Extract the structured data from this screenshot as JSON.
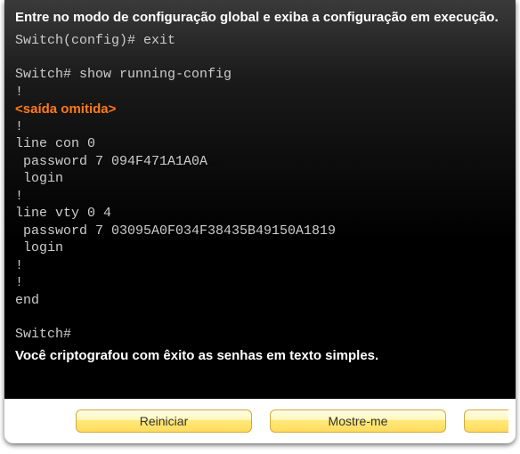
{
  "heading": "Entre no modo de configuração global e exiba a configuração em execução.",
  "terminal": {
    "lines": [
      "Switch(config)# exit",
      "",
      "Switch# show running-config",
      "!"
    ],
    "annotation": "<saída omitida>",
    "lines2": [
      "!",
      "line con 0",
      " password 7 094F471A1A0A",
      " login",
      "!",
      "line vty 0 4",
      " password 7 03095A0F034F38435B49150A1819",
      " login",
      "!",
      "!",
      "end",
      "",
      "Switch#"
    ]
  },
  "result": "Você criptografou com êxito as senhas em texto simples.",
  "buttons": {
    "restart": "Reiniciar",
    "showme": "Mostre-me"
  }
}
